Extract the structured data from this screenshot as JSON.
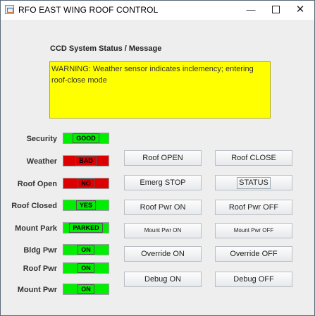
{
  "window": {
    "title": "RFO EAST WING ROOF CONTROL"
  },
  "colors": {
    "good": "#00ee00",
    "bad": "#dd0000",
    "message_bg": "#ffff00"
  },
  "ccd": {
    "title": "CCD System Status / Message",
    "message": "WARNING: Weather sensor indicates inclemency; entering roof-close mode"
  },
  "status": [
    {
      "label": "Security",
      "value": "GOOD",
      "state": "good"
    },
    {
      "label": "Weather",
      "value": "BAD",
      "state": "bad"
    },
    {
      "label": "Roof Open",
      "value": "NO",
      "state": "bad"
    },
    {
      "label": "Roof Closed",
      "value": "YES",
      "state": "good"
    },
    {
      "label": "Mount Park",
      "value": "PARKED",
      "state": "good"
    },
    {
      "label": "Bldg Pwr",
      "value": "ON",
      "state": "good"
    },
    {
      "label": "Roof Pwr",
      "value": "ON",
      "state": "good"
    },
    {
      "label": "Mount Pwr",
      "value": "ON",
      "state": "good"
    }
  ],
  "buttons": {
    "roof_open": "Roof OPEN",
    "roof_close": "Roof CLOSE",
    "emerg_stop": "Emerg STOP",
    "status": "STATUS",
    "roof_pwr_on": "Roof Pwr ON",
    "roof_pwr_off": "Roof Pwr OFF",
    "mount_pwr_on": "Mount Pwr ON",
    "mount_pwr_off": "Mount Pwr OFF",
    "override_on": "Override ON",
    "override_off": "Override OFF",
    "debug_on": "Debug ON",
    "debug_off": "Debug OFF"
  }
}
